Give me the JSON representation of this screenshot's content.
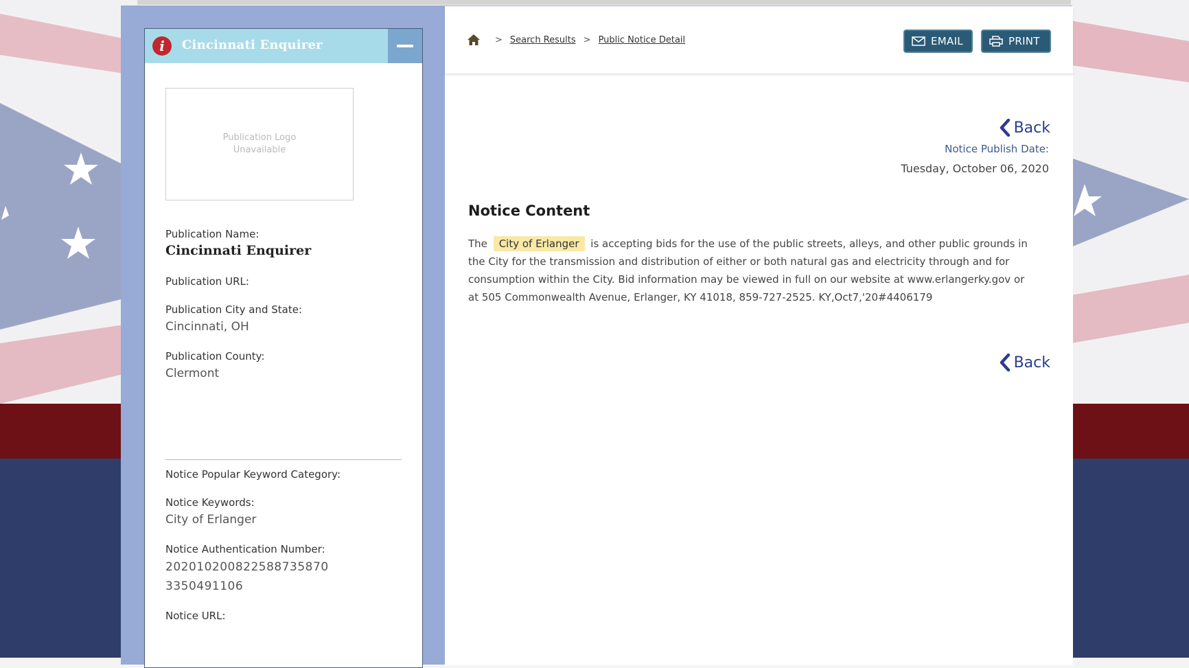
{
  "sidebar": {
    "title": "Cincinnati Enquirer",
    "logo_placeholder": "Publication Logo\nUnavailable",
    "fields": {
      "publication_name_label": "Publication Name:",
      "publication_name": "Cincinnati Enquirer",
      "publication_url_label": "Publication URL:",
      "publication_city_state_label": "Publication City and State:",
      "publication_city_state": "Cincinnati, OH",
      "publication_county_label": "Publication County:",
      "publication_county": "Clermont",
      "keyword_category_label": "Notice Popular Keyword Category:",
      "keywords_label": "Notice Keywords:",
      "keywords": "City of Erlanger",
      "auth_number_label": "Notice Authentication Number:",
      "auth_number_line1": "202010200822588735870",
      "auth_number_line2": "3350491106",
      "notice_url_label": "Notice URL:"
    }
  },
  "breadcrumb": {
    "separator": ">",
    "search_results": "Search Results",
    "current": "Public Notice Detail"
  },
  "toolbar": {
    "email_label": "EMAIL",
    "print_label": "PRINT"
  },
  "notice": {
    "back_label": "Back",
    "publish_date_label": "Notice Publish Date:",
    "publish_date": "Tuesday, October 06, 2020",
    "content_title": "Notice Content",
    "body_prefix": "The",
    "highlight": "City of Erlanger",
    "body_rest": "is accepting bids for the use of the public streets, alleys, and other public grounds in the City for the transmission and distribution of either or both natural gas and electricity through and for consumption within the City. Bid information may be viewed in full on our website at www.erlangerky.gov or at 505 Commonwealth Avenue, Erlanger, KY 41018, 859-727-2525. KY,Oct7,'20#4406179"
  },
  "colors": {
    "sidebar_header": "#a8dbe9",
    "info_badge": "#c0282e",
    "button": "#2b5a76",
    "back_link": "#2b3d8f",
    "highlight": "#f8e9a6",
    "container": "#97abd6"
  },
  "icons": {
    "info": "info-icon",
    "collapse": "minus-icon",
    "home": "home-icon",
    "email": "envelope-icon",
    "print": "printer-icon",
    "back": "chevron-left-icon"
  }
}
